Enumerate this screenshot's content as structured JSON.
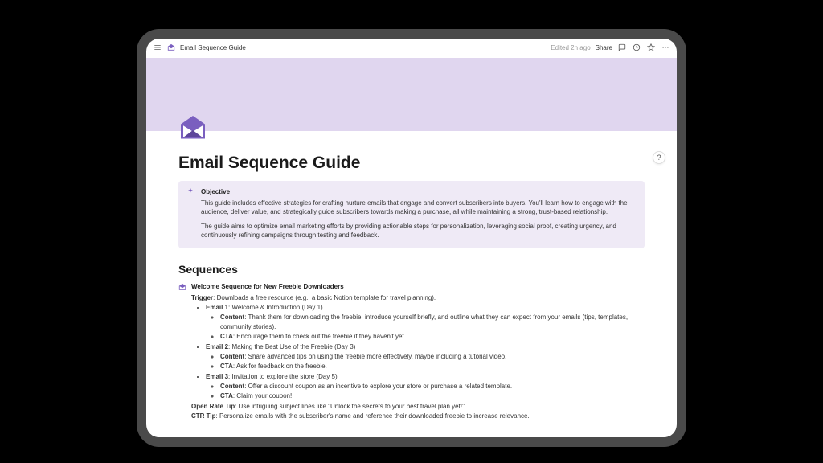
{
  "topbar": {
    "breadcrumb_title": "Email Sequence Guide",
    "edited": "Edited 2h ago",
    "share": "Share"
  },
  "page": {
    "title": "Email Sequence Guide",
    "objective_label": "Objective",
    "objective_p1": "This guide includes effective strategies for crafting nurture emails that engage and convert subscribers into buyers. You'll learn how to engage with the audience, deliver value, and strategically guide subscribers towards making a purchase, all while maintaining a strong, trust-based relationship.",
    "objective_p2": "The guide aims to optimize email marketing efforts by providing actionable steps for personalization, leveraging social proof, creating urgency, and continuously refining campaigns through testing and feedback.",
    "sequences_heading": "Sequences"
  },
  "sequence": {
    "title": "Welcome Sequence for New Freebie Downloaders",
    "trigger_label": "Trigger",
    "trigger_text": ": Downloads a free resource (e.g., a basic Notion template for travel planning).",
    "emails": [
      {
        "heading_label": "Email 1",
        "heading_rest": ": Welcome & Introduction (Day 1)",
        "content_label": "Content",
        "content_text": ": Thank them for downloading the freebie, introduce yourself briefly, and outline what they can expect from your emails (tips, templates, community stories).",
        "cta_label": "CTA",
        "cta_text": ": Encourage them to check out the freebie if they haven't yet."
      },
      {
        "heading_label": "Email 2",
        "heading_rest": ": Making the Best Use of the Freebie (Day 3)",
        "content_label": "Content",
        "content_text": ": Share advanced tips on using the freebie more effectively, maybe including a tutorial video.",
        "cta_label": "CTA",
        "cta_text": ": Ask for feedback on the freebie."
      },
      {
        "heading_label": "Email 3",
        "heading_rest": ": Invitation to explore the store (Day 5)",
        "content_label": "Content",
        "content_text": ": Offer a discount coupon as an incentive to explore your store or purchase a related template.",
        "cta_label": "CTA",
        "cta_text": ": Claim your coupon!"
      }
    ],
    "open_rate_label": "Open Rate Tip",
    "open_rate_text": ": Use intriguing subject lines like \"Unlock the secrets to your best travel plan yet!\"",
    "ctr_label": "CTR Tip",
    "ctr_text": ": Personalize emails with the subscriber's name and reference their downloaded freebie to increase relevance."
  },
  "help": "?"
}
